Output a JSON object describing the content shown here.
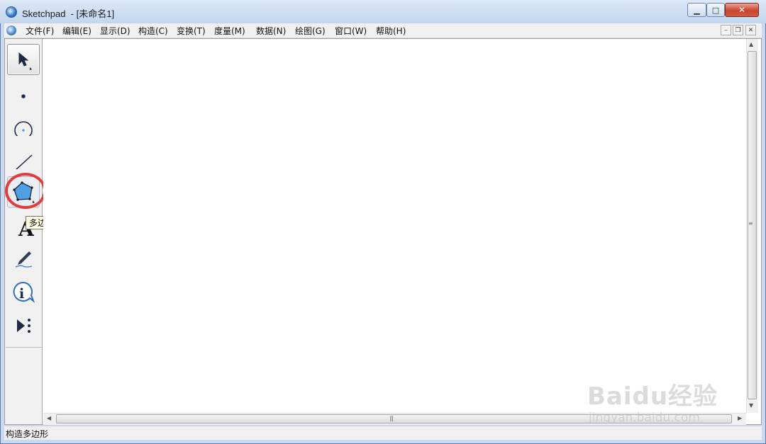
{
  "window": {
    "title": "Sketchpad  - [未命名1]",
    "minimize": "▁",
    "maximize": "□",
    "close": "✕"
  },
  "menu": {
    "items": [
      "文件(F)",
      "编辑(E)",
      "显示(D)",
      "构造(C)",
      "变换(T)",
      "度量(M)",
      "数据(N)",
      "绘图(G)",
      "窗口(W)",
      "帮助(H)"
    ],
    "doc_minimize": "–",
    "doc_restore": "❐",
    "doc_close": "✕"
  },
  "toolbox": {
    "tools": [
      {
        "name": "selection-arrow-tool",
        "state": "selected"
      },
      {
        "name": "point-tool"
      },
      {
        "name": "compass-tool"
      },
      {
        "name": "straightedge-tool"
      },
      {
        "name": "polygon-tool",
        "state": "highlighted"
      },
      {
        "name": "text-tool"
      },
      {
        "name": "marker-tool"
      },
      {
        "name": "information-tool"
      },
      {
        "name": "custom-tools"
      }
    ],
    "tooltip": "多边形工具"
  },
  "status": {
    "text": "构造多边形"
  },
  "scrollbar": {
    "h_grip": "|||",
    "v_grip": "≡"
  },
  "watermark": {
    "main": "Baidu经验",
    "sub": "jingyan.baidu.com"
  },
  "colors": {
    "highlight_ring": "#e23b3b",
    "polygon_fill": "#4f9fe3",
    "tooltip_bg": "#ffffe1"
  }
}
